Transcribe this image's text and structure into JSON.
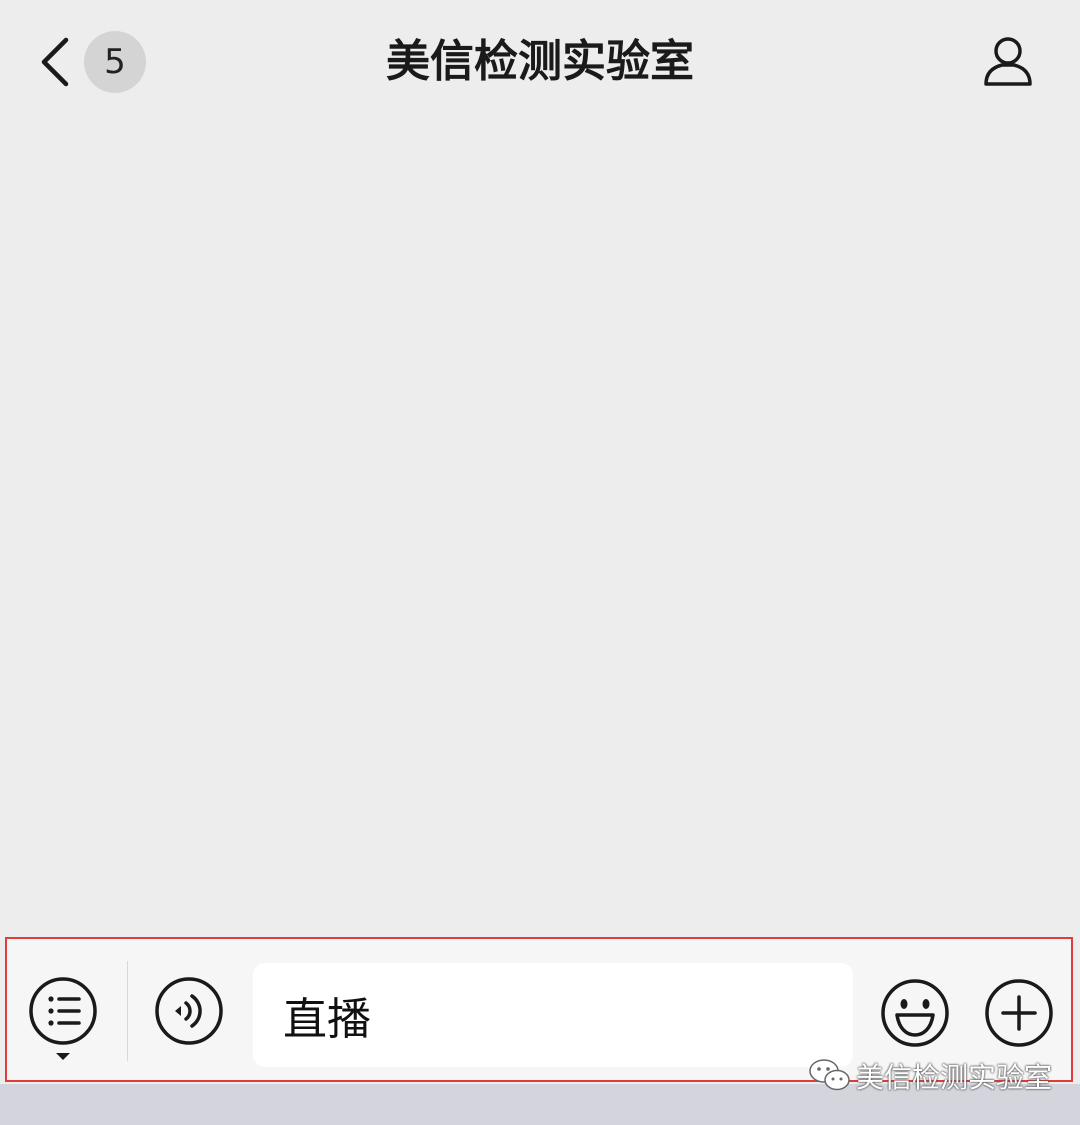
{
  "header": {
    "title": "美信检测实验室",
    "unread_count": "5",
    "back_icon": "chevron-left-icon",
    "profile_icon": "person-icon"
  },
  "input_bar": {
    "input_value": "直播",
    "menu_icon": "list-menu-icon",
    "voice_icon": "voice-icon",
    "emoji_icon": "smiley-icon",
    "plus_icon": "plus-circle-icon",
    "highlight_color": "#e23b3b"
  },
  "watermark": {
    "text": "美信检测实验室",
    "icon": "wechat-icon"
  }
}
